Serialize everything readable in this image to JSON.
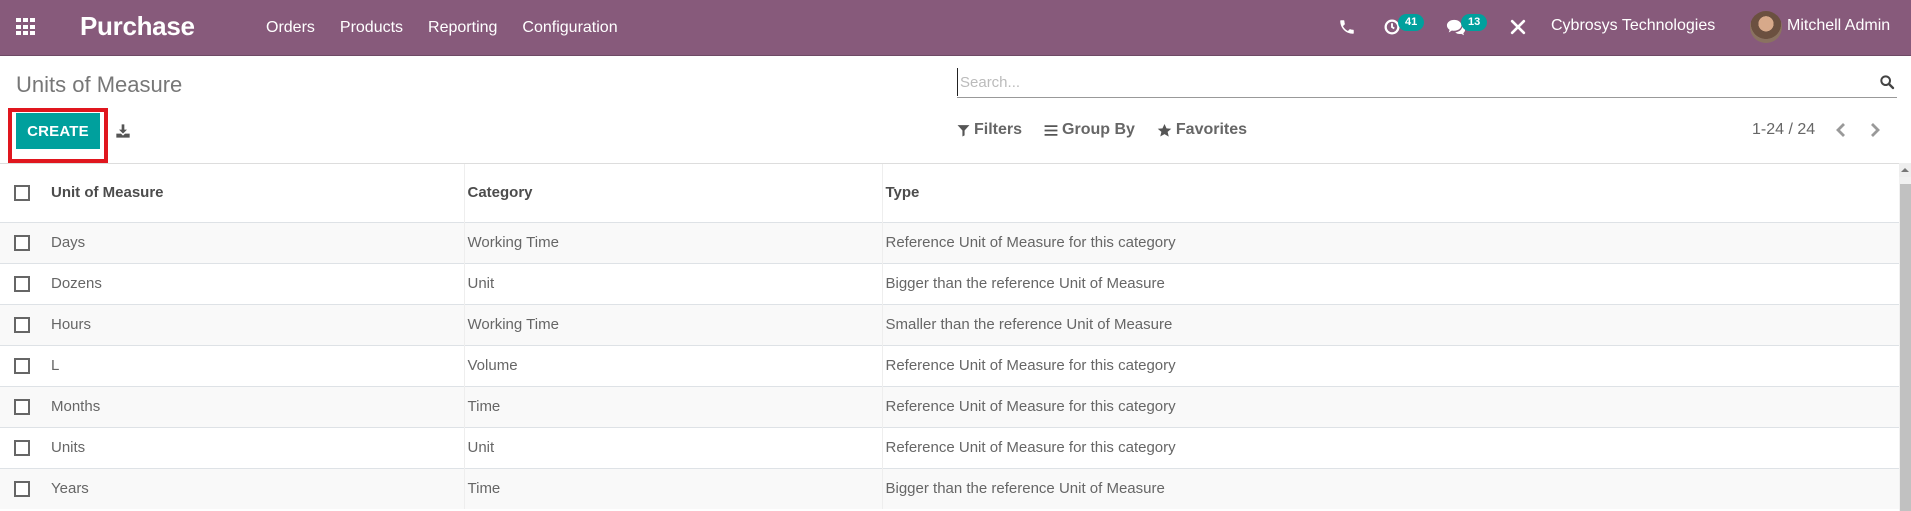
{
  "navbar": {
    "app_name": "Purchase",
    "menu": [
      "Orders",
      "Products",
      "Reporting",
      "Configuration"
    ],
    "activity_count": "41",
    "message_count": "13",
    "company": "Cybrosys Technologies",
    "user": "Mitchell Admin",
    "icons": {
      "apps": "apps-grid-icon",
      "phone": "phone-icon",
      "activity": "clock-icon",
      "messages": "chat-icon",
      "tools": "tools-icon"
    }
  },
  "control_panel": {
    "title": "Units of Measure",
    "create_label": "CREATE",
    "search_placeholder": "Search...",
    "filters_label": "Filters",
    "group_by_label": "Group By",
    "favorites_label": "Favorites",
    "pager": "1-24 / 24"
  },
  "colors": {
    "navbar": "#875a7b",
    "primary": "#00a09d",
    "highlight": "#e0161e"
  },
  "list": {
    "headers": [
      "Unit of Measure",
      "Category",
      "Type"
    ],
    "rows": [
      {
        "name": "Days",
        "category": "Working Time",
        "type": "Reference Unit of Measure for this category"
      },
      {
        "name": "Dozens",
        "category": "Unit",
        "type": "Bigger than the reference Unit of Measure"
      },
      {
        "name": "Hours",
        "category": "Working Time",
        "type": "Smaller than the reference Unit of Measure"
      },
      {
        "name": "L",
        "category": "Volume",
        "type": "Reference Unit of Measure for this category"
      },
      {
        "name": "Months",
        "category": "Time",
        "type": "Reference Unit of Measure for this category"
      },
      {
        "name": "Units",
        "category": "Unit",
        "type": "Reference Unit of Measure for this category"
      },
      {
        "name": "Years",
        "category": "Time",
        "type": "Bigger than the reference Unit of Measure"
      }
    ]
  }
}
